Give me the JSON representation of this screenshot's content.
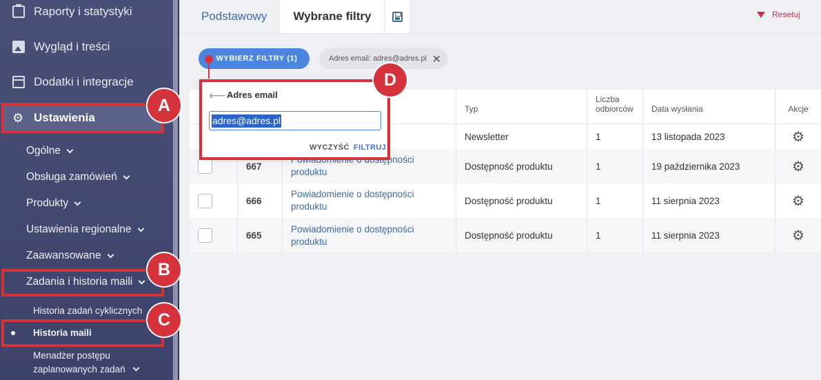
{
  "sidebar": {
    "top_items": [
      "Raporty i statystyki",
      "Wygląd i treści",
      "Dodatki i integracje",
      "Ustawienia"
    ],
    "sub_items": [
      "Ogólne",
      "Obsługa zamówień",
      "Produkty",
      "Ustawienia regionalne",
      "Zaawansowane",
      "Zadania i historia maili"
    ],
    "subsub_items": [
      "Historia zadań cyklicznych",
      "Historia maili",
      "Menadżer postępu",
      "zaplanowanych zadań"
    ]
  },
  "tabs": {
    "basic": "Podstawowy",
    "selected": "Wybrane filtry"
  },
  "reset_label": "Resetuj",
  "filter_button": "WYBIERZ FILTRY (1)",
  "chip": "Adres email: adres@adres.pl",
  "popup": {
    "title": "Adres email",
    "value": "adres@adres.pl",
    "clear": "WYCZYŚĆ",
    "apply": "FILTRUJ"
  },
  "table": {
    "headers": {
      "typ": "Typ",
      "liczba1": "Liczba",
      "liczba2": "odbiorców",
      "data": "Data wysłania",
      "akcje": "Akcje"
    },
    "rows": [
      {
        "id": "",
        "name1": "",
        "name2": "",
        "type": "Newsletter",
        "count": "1",
        "date": "13 listopada 2023"
      },
      {
        "id": "667",
        "name1": "Powiadomienie o dostępności",
        "name2": "produktu",
        "type": "Dostępność produktu",
        "count": "1",
        "date": "19 października 2023"
      },
      {
        "id": "666",
        "name1": "Powiadomienie o dostępności",
        "name2": "produktu",
        "type": "Dostępność produktu",
        "count": "1",
        "date": "11 sierpnia 2023"
      },
      {
        "id": "665",
        "name1": "Powiadomienie o dostępności",
        "name2": "produktu",
        "type": "Dostępność produktu",
        "count": "1",
        "date": "11 sierpnia 2023"
      }
    ]
  },
  "annotations": {
    "a": "A",
    "b": "B",
    "c": "C",
    "d": "D"
  },
  "colors": {
    "sidebar": "#454a72",
    "accent": "#4a86e0",
    "annotation": "#d5333c"
  }
}
